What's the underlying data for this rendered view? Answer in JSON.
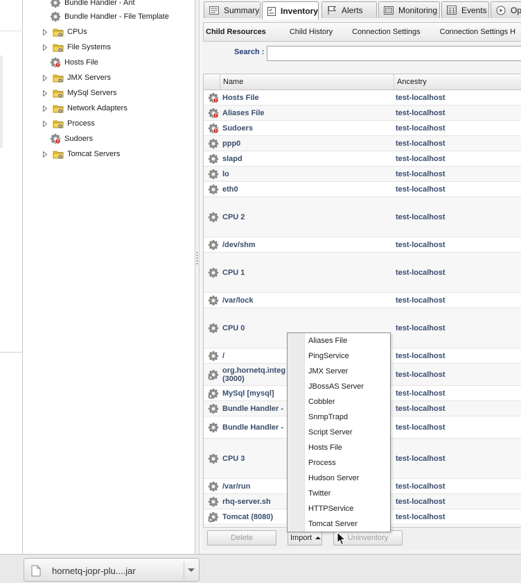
{
  "tree": {
    "items": [
      {
        "label": "Bundle Handler - Ant",
        "icon": "gear-icon",
        "expandable": false
      },
      {
        "label": "Bundle Handler - File Template",
        "icon": "gear-icon",
        "expandable": false
      },
      {
        "label": "CPUs",
        "icon": "folder-icon",
        "expandable": true
      },
      {
        "label": "File Systems",
        "icon": "folder-icon",
        "expandable": true
      },
      {
        "label": "Hosts File",
        "icon": "gear-error-icon",
        "expandable": false
      },
      {
        "label": "JMX Servers",
        "icon": "folder-icon",
        "expandable": true
      },
      {
        "label": "MySql Servers",
        "icon": "folder-icon",
        "expandable": true
      },
      {
        "label": "Network Adapters",
        "icon": "folder-icon",
        "expandable": true
      },
      {
        "label": "Process",
        "icon": "folder-icon",
        "expandable": true
      },
      {
        "label": "Sudoers",
        "icon": "gear-error-icon",
        "expandable": false
      },
      {
        "label": "Tomcat Servers",
        "icon": "folder-icon",
        "expandable": true
      }
    ]
  },
  "tabs": [
    {
      "label": "Summary",
      "icon": "summary-icon",
      "active": false
    },
    {
      "label": "Inventory",
      "icon": "inventory-icon",
      "active": true
    },
    {
      "label": "Alerts",
      "icon": "flag-icon",
      "active": false
    },
    {
      "label": "Monitoring",
      "icon": "monitor-icon",
      "active": false
    },
    {
      "label": "Events",
      "icon": "calendar-icon",
      "active": false
    },
    {
      "label": "Op",
      "icon": "play-icon",
      "active": false
    }
  ],
  "subtabs": [
    {
      "label": "Child Resources",
      "active": true
    },
    {
      "label": "Child History",
      "active": false
    },
    {
      "label": "Connection Settings",
      "active": false
    },
    {
      "label": "Connection Settings H",
      "active": false
    }
  ],
  "search": {
    "label": "Search :",
    "value": ""
  },
  "grid": {
    "columns": [
      "Name",
      "Ancestry"
    ],
    "rows": [
      {
        "name": "Hosts File",
        "ancestry": "test-localhost",
        "icon": "gear-error-icon"
      },
      {
        "name": "Aliases File",
        "ancestry": "test-localhost",
        "icon": "gear-error-icon"
      },
      {
        "name": "Sudoers",
        "ancestry": "test-localhost",
        "icon": "gear-error-icon"
      },
      {
        "name": "ppp0",
        "ancestry": "test-localhost",
        "icon": "gear-icon"
      },
      {
        "name": "slapd",
        "ancestry": "test-localhost",
        "icon": "gear-icon"
      },
      {
        "name": "lo",
        "ancestry": "test-localhost",
        "icon": "gear-icon"
      },
      {
        "name": "eth0",
        "ancestry": "test-localhost",
        "icon": "gear-icon"
      },
      {
        "name": "CPU 2",
        "ancestry": "test-localhost",
        "icon": "gear-icon"
      },
      {
        "name": "/dev/shm",
        "ancestry": "test-localhost",
        "icon": "gear-icon"
      },
      {
        "name": "CPU 1",
        "ancestry": "test-localhost",
        "icon": "gear-icon"
      },
      {
        "name": "/var/lock",
        "ancestry": "test-localhost",
        "icon": "gear-icon"
      },
      {
        "name": "CPU 0",
        "ancestry": "test-localhost",
        "icon": "gear-icon"
      },
      {
        "name": "/",
        "ancestry": "test-localhost",
        "icon": "gear-icon"
      },
      {
        "name": "org.hornetq.integ",
        "name2": "(3000)",
        "ancestry": "test-localhost",
        "icon": "gears-icon"
      },
      {
        "name": "MySql [mysql]",
        "ancestry": "test-localhost",
        "icon": "gears-icon"
      },
      {
        "name": "Bundle Handler - ",
        "ancestry": "test-localhost",
        "icon": "gear-icon"
      },
      {
        "name": "Bundle Handler - ",
        "ancestry": "test-localhost",
        "icon": "gear-icon"
      },
      {
        "name": "CPU 3",
        "ancestry": "test-localhost",
        "icon": "gear-icon"
      },
      {
        "name": "/var/run",
        "ancestry": "test-localhost",
        "icon": "gear-icon"
      },
      {
        "name": "rhq-server.sh",
        "ancestry": "test-localhost",
        "icon": "gear-icon"
      },
      {
        "name": "Tomcat (8080)",
        "ancestry": "test-localhost",
        "icon": "gears-icon"
      }
    ]
  },
  "import_menu": {
    "items": [
      "Aliases File",
      "PingService",
      "JMX Server",
      "JBossAS Server",
      "Cobbler",
      "SnmpTrapd",
      "Script Server",
      "Hosts File",
      "Process",
      "Hudson Server",
      "Twitter",
      "HTTPService",
      "Tomcat Server"
    ]
  },
  "buttons": {
    "delete": "Delete",
    "import": "Import",
    "uninventory": "Uninventory"
  },
  "download": {
    "filename": "hornetq-jopr-plu....jar"
  }
}
